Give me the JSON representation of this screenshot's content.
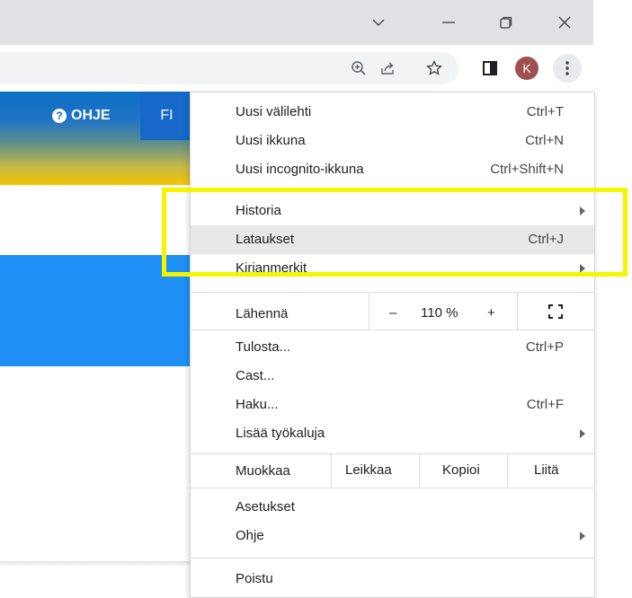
{
  "window": {
    "controls": [
      "chevron-down-icon",
      "minimize-icon",
      "restore-icon",
      "close-icon"
    ]
  },
  "toolbar": {
    "icons": [
      "zoom-icon",
      "share-icon",
      "bookmark-star-icon",
      "side-panel-icon"
    ],
    "avatar_letter": "K",
    "menu_icon": "kebab-menu-icon"
  },
  "site": {
    "help_label": "OHJE",
    "language": "FI",
    "colors": {
      "header_top": "#0d6fc4",
      "header_bottom": "#f6c400",
      "band": "#1e90f5"
    }
  },
  "menu": {
    "group1": [
      {
        "label": "Uusi välilehti",
        "shortcut": "Ctrl+T"
      },
      {
        "label": "Uusi ikkuna",
        "shortcut": "Ctrl+N"
      },
      {
        "label": "Uusi incognito-ikkuna",
        "shortcut": "Ctrl+Shift+N"
      }
    ],
    "group2": [
      {
        "label": "Historia",
        "submenu": true
      },
      {
        "label": "Lataukset",
        "shortcut": "Ctrl+J",
        "highlighted": true
      },
      {
        "label": "Kirjanmerkit",
        "submenu": true
      }
    ],
    "zoom": {
      "label": "Lähennä",
      "minus": "–",
      "value": "110 %",
      "plus": "+",
      "fullscreen_icon": "fullscreen-icon"
    },
    "group3": [
      {
        "label": "Tulosta...",
        "shortcut": "Ctrl+P"
      },
      {
        "label": "Cast..."
      },
      {
        "label": "Haku...",
        "shortcut": "Ctrl+F"
      },
      {
        "label": "Lisää työkaluja",
        "submenu": true
      }
    ],
    "edit": {
      "label": "Muokkaa",
      "cut": "Leikkaa",
      "copy": "Kopioi",
      "paste": "Liitä"
    },
    "group4": [
      {
        "label": "Asetukset"
      },
      {
        "label": "Ohje",
        "submenu": true
      }
    ],
    "exit": {
      "label": "Poistu"
    }
  },
  "annotation": {
    "color": "#f5f500"
  }
}
